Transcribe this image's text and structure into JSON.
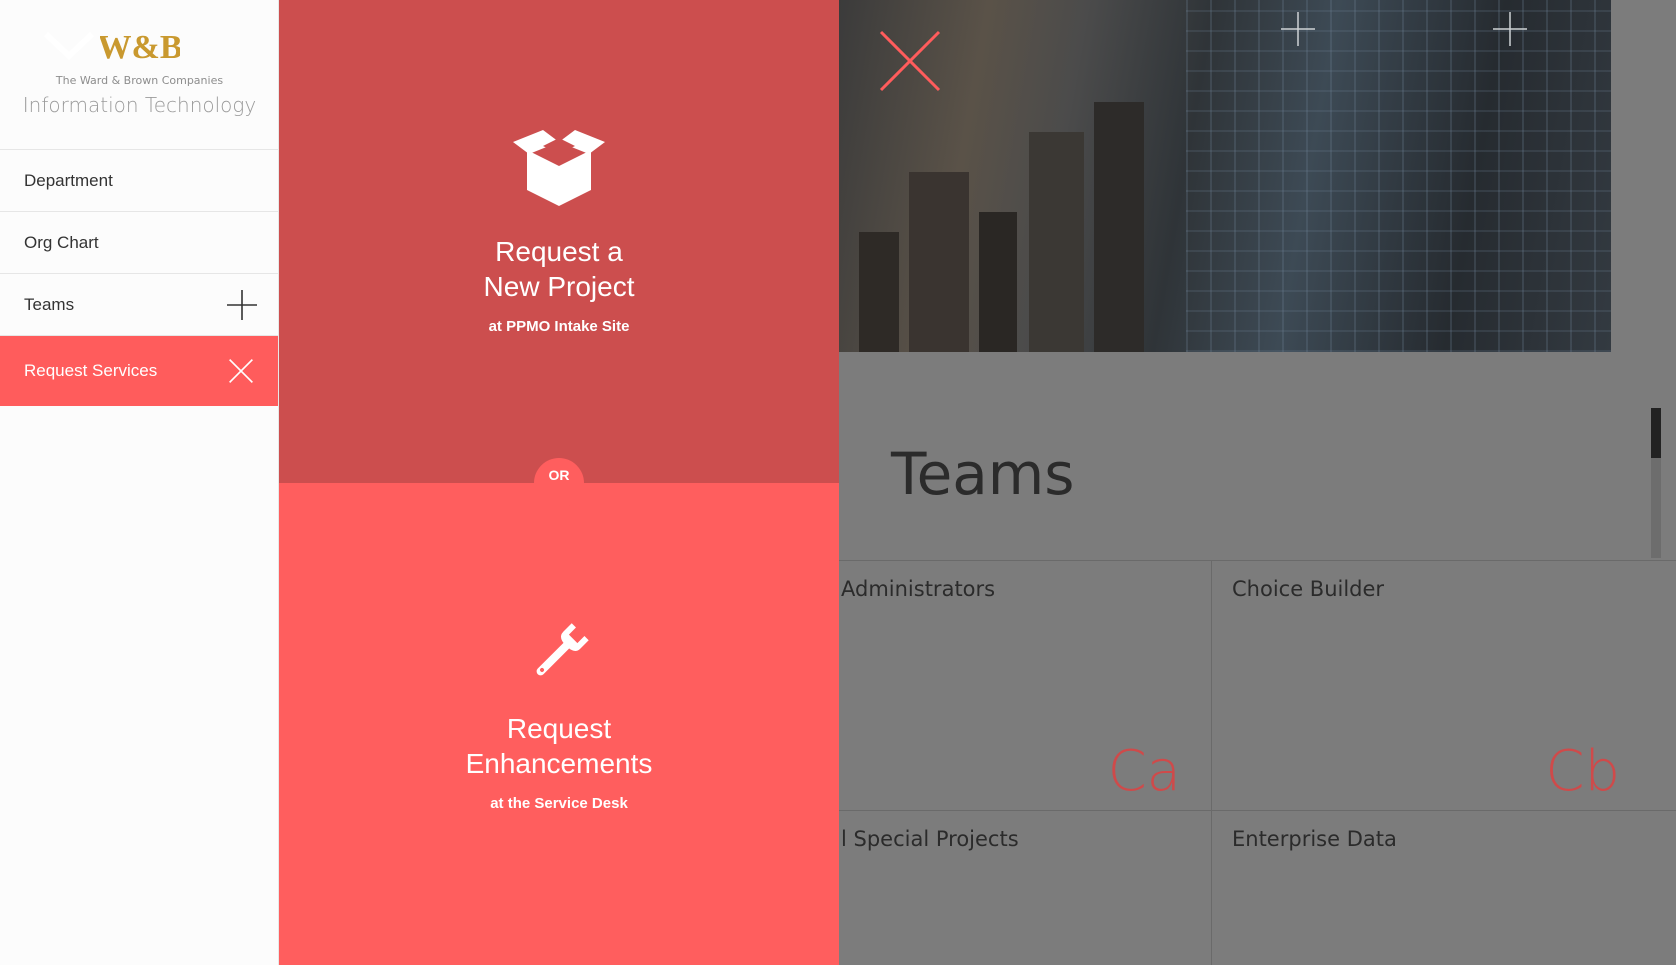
{
  "brand": {
    "logo_text": "W&B",
    "company": "The Ward & Brown Companies",
    "department": "Information Technology"
  },
  "nav": {
    "items": [
      {
        "label": "Department"
      },
      {
        "label": "Org Chart"
      },
      {
        "label": "Teams",
        "toggle_icon": "plus-icon"
      },
      {
        "label": "Request Services",
        "toggle_icon": "close-icon",
        "active": true
      }
    ]
  },
  "panel": {
    "project": {
      "icon": "box-icon",
      "title_line1": "Request a",
      "title_line2": "New Project",
      "subtitle": "at PPMO Intake Site"
    },
    "or_label": "OR",
    "enhancements": {
      "icon": "wrench-icon",
      "title_line1": "Request",
      "title_line2": "Enhancements",
      "subtitle": "at the Service Desk"
    }
  },
  "page": {
    "section_title": "Teams",
    "teams": [
      {
        "name": "Administrators",
        "abbr": "Ca"
      },
      {
        "name": "Choice Builder",
        "abbr": "Cb"
      },
      {
        "name": "l Special Projects",
        "abbr": ""
      },
      {
        "name": "Enterprise Data",
        "abbr": ""
      }
    ]
  },
  "colors": {
    "accent": "#ff5c5c",
    "panel_top": "#cc4e4e",
    "panel_bottom": "#ff5e5e",
    "overlay": "#7c7c7c"
  }
}
